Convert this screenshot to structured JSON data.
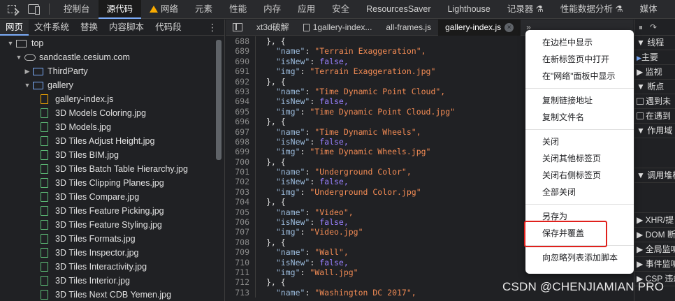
{
  "toolbar": {
    "tabs": [
      {
        "label": "控制台"
      },
      {
        "label": "源代码",
        "active": true
      },
      {
        "label": "网络",
        "warning": true
      },
      {
        "label": "元素"
      },
      {
        "label": "性能"
      },
      {
        "label": "内存"
      },
      {
        "label": "应用"
      },
      {
        "label": "安全"
      },
      {
        "label": "ResourcesSaver"
      },
      {
        "label": "Lighthouse"
      },
      {
        "label": "记录器 ⚗"
      },
      {
        "label": "性能数据分析 ⚗"
      },
      {
        "label": "媒体"
      }
    ]
  },
  "navigator": {
    "tabs": [
      "网页",
      "文件系统",
      "替换",
      "内容脚本",
      "代码段"
    ],
    "more_label": "⋮",
    "tree": [
      {
        "label": "top",
        "icon": "frame-icon",
        "depth": 0,
        "expanded": true
      },
      {
        "label": "sandcastle.cesium.com",
        "icon": "cloud-icon",
        "depth": 1,
        "expanded": true
      },
      {
        "label": "ThirdParty",
        "icon": "folder-icon",
        "depth": 2,
        "expanded": false
      },
      {
        "label": "gallery",
        "icon": "folder-icon",
        "depth": 2,
        "expanded": true
      },
      {
        "label": "gallery-index.js",
        "icon": "js-file-icon",
        "depth": 3
      },
      {
        "label": "3D Models Coloring.jpg",
        "icon": "image-file-icon",
        "depth": 3
      },
      {
        "label": "3D Models.jpg",
        "icon": "image-file-icon",
        "depth": 3
      },
      {
        "label": "3D Tiles Adjust Height.jpg",
        "icon": "image-file-icon",
        "depth": 3
      },
      {
        "label": "3D Tiles BIM.jpg",
        "icon": "image-file-icon",
        "depth": 3
      },
      {
        "label": "3D Tiles Batch Table Hierarchy.jpg",
        "icon": "image-file-icon",
        "depth": 3
      },
      {
        "label": "3D Tiles Clipping Planes.jpg",
        "icon": "image-file-icon",
        "depth": 3
      },
      {
        "label": "3D Tiles Compare.jpg",
        "icon": "image-file-icon",
        "depth": 3
      },
      {
        "label": "3D Tiles Feature Picking.jpg",
        "icon": "image-file-icon",
        "depth": 3
      },
      {
        "label": "3D Tiles Feature Styling.jpg",
        "icon": "image-file-icon",
        "depth": 3
      },
      {
        "label": "3D Tiles Formats.jpg",
        "icon": "image-file-icon",
        "depth": 3
      },
      {
        "label": "3D Tiles Inspector.jpg",
        "icon": "image-file-icon",
        "depth": 3
      },
      {
        "label": "3D Tiles Interactivity.jpg",
        "icon": "image-file-icon",
        "depth": 3
      },
      {
        "label": "3D Tiles Interior.jpg",
        "icon": "image-file-icon",
        "depth": 3
      },
      {
        "label": "3D Tiles Next CDB Yemen.jpg",
        "icon": "image-file-icon",
        "depth": 3
      }
    ]
  },
  "editor": {
    "tabs": [
      {
        "label": "xt3d破解",
        "icon": "none"
      },
      {
        "label": "1gallery-index...",
        "icon": "doc"
      },
      {
        "label": "all-frames.js",
        "icon": "none"
      },
      {
        "label": "gallery-index.js",
        "icon": "none",
        "active": true,
        "close": "×"
      }
    ],
    "overflow_label": "»",
    "lines": [
      {
        "n": "688",
        "t": "}, {",
        "kind": "punct"
      },
      {
        "n": "689",
        "key": "name",
        "val": "\"Terrain Exaggeration\",",
        "kind": "str"
      },
      {
        "n": "690",
        "key": "isNew",
        "val": "false,",
        "kind": "bool"
      },
      {
        "n": "691",
        "key": "img",
        "val": "\"Terrain Exaggeration.jpg\"",
        "kind": "str"
      },
      {
        "n": "692",
        "t": "}, {",
        "kind": "punct"
      },
      {
        "n": "693",
        "key": "name",
        "val": "\"Time Dynamic Point Cloud\",",
        "kind": "str"
      },
      {
        "n": "694",
        "key": "isNew",
        "val": "false,",
        "kind": "bool"
      },
      {
        "n": "695",
        "key": "img",
        "val": "\"Time Dynamic Point Cloud.jpg\"",
        "kind": "str"
      },
      {
        "n": "696",
        "t": "}, {",
        "kind": "punct"
      },
      {
        "n": "697",
        "key": "name",
        "val": "\"Time Dynamic Wheels\",",
        "kind": "str"
      },
      {
        "n": "698",
        "key": "isNew",
        "val": "false,",
        "kind": "bool"
      },
      {
        "n": "699",
        "key": "img",
        "val": "\"Time Dynamic Wheels.jpg\"",
        "kind": "str"
      },
      {
        "n": "700",
        "t": "}, {",
        "kind": "punct"
      },
      {
        "n": "701",
        "key": "name",
        "val": "\"Underground Color\",",
        "kind": "str"
      },
      {
        "n": "702",
        "key": "isNew",
        "val": "false,",
        "kind": "bool"
      },
      {
        "n": "703",
        "key": "img",
        "val": "\"Underground Color.jpg\"",
        "kind": "str"
      },
      {
        "n": "704",
        "t": "}, {",
        "kind": "punct"
      },
      {
        "n": "705",
        "key": "name",
        "val": "\"Video\",",
        "kind": "str"
      },
      {
        "n": "706",
        "key": "isNew",
        "val": "false,",
        "kind": "bool"
      },
      {
        "n": "707",
        "key": "img",
        "val": "\"Video.jpg\"",
        "kind": "str"
      },
      {
        "n": "708",
        "t": "}, {",
        "kind": "punct"
      },
      {
        "n": "709",
        "key": "name",
        "val": "\"Wall\",",
        "kind": "str"
      },
      {
        "n": "710",
        "key": "isNew",
        "val": "false,",
        "kind": "bool"
      },
      {
        "n": "711",
        "key": "img",
        "val": "\"Wall.jpg\"",
        "kind": "str"
      },
      {
        "n": "712",
        "t": "}, {",
        "kind": "punct"
      },
      {
        "n": "713",
        "key": "name",
        "val": "\"Washington DC 2017\",",
        "kind": "str"
      }
    ]
  },
  "context_menu": {
    "groups": [
      [
        "在边栏中显示",
        "在新标签页中打开",
        "在\"网络\"面板中显示"
      ],
      [
        "复制链接地址",
        "复制文件名"
      ],
      [
        "关闭",
        "关闭其他标签页",
        "关闭右侧标签页",
        "全部关闭"
      ],
      [
        "另存为",
        "保存并覆盖"
      ],
      [
        "向忽略列表添加脚本"
      ]
    ],
    "highlighted_item": "保存并覆盖",
    "highlight_color": "#e0201c"
  },
  "debugger_sidebar": {
    "rows": [
      {
        "label": "▼ 线程",
        "type": "header"
      },
      {
        "label": "主要",
        "type": "item",
        "marker": "▶"
      },
      {
        "label": "▶ 监视",
        "type": "header"
      },
      {
        "label": "▼ 断点",
        "type": "header"
      },
      {
        "label": "遇到未",
        "type": "checkbox"
      },
      {
        "label": "在遇到",
        "type": "checkbox"
      },
      {
        "label": "▼ 作用域",
        "type": "header"
      },
      {
        "label": "",
        "type": "gap"
      },
      {
        "label": "▼ 调用堆栈",
        "type": "header"
      },
      {
        "label": "",
        "type": "gap"
      },
      {
        "label": "▶ XHR/提",
        "type": "header"
      },
      {
        "label": "▶ DOM 断",
        "type": "header"
      },
      {
        "label": "▶ 全局监听",
        "type": "header"
      },
      {
        "label": "▶ 事件监听",
        "type": "header"
      },
      {
        "label": "▶ CSP 违规",
        "type": "header"
      }
    ]
  },
  "watermark": "CSDN @CHENJIAMIAN PRO",
  "colors": {
    "accent": "#7cacf8",
    "string": "#f28b54",
    "key": "#9bbbdc",
    "boolean": "#9980ff",
    "js_file": "#f9ab00",
    "image_file": "#5bb974"
  }
}
